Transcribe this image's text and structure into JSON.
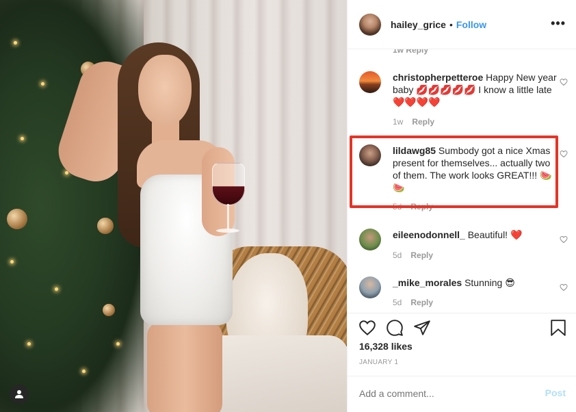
{
  "post": {
    "username": "hailey_grice",
    "dot": "•",
    "follow_label": "Follow",
    "more_icon": "more-options-icon"
  },
  "comments": {
    "top_reply_strip": "1w  Reply",
    "items": [
      {
        "username": "christopherpetteroe",
        "text": "Happy New year baby 💋💋💋💋💋 I know a little late ❤️❤️❤️❤️",
        "time": "1w",
        "reply": "Reply"
      },
      {
        "username": "lildawg85",
        "text": "Sumbody got a nice Xmas present for themselves... actually two of them. The work looks GREAT!!! 🍉🍉",
        "time": "5d",
        "reply": "Reply"
      },
      {
        "username": "eileenodonnell_",
        "text": "Beautiful! ❤️",
        "time": "5d",
        "reply": "Reply"
      },
      {
        "username": "_mike_morales",
        "text": "Stunning 😎",
        "time": "5d",
        "reply": "Reply"
      }
    ]
  },
  "actions": {
    "likes": "16,328 likes",
    "date": "JANUARY 1"
  },
  "add_comment": {
    "placeholder": "Add a comment...",
    "post_label": "Post"
  },
  "colors": {
    "accent": "#3897f0",
    "highlight": "#e63326",
    "post_disabled": "#b2dffc"
  }
}
